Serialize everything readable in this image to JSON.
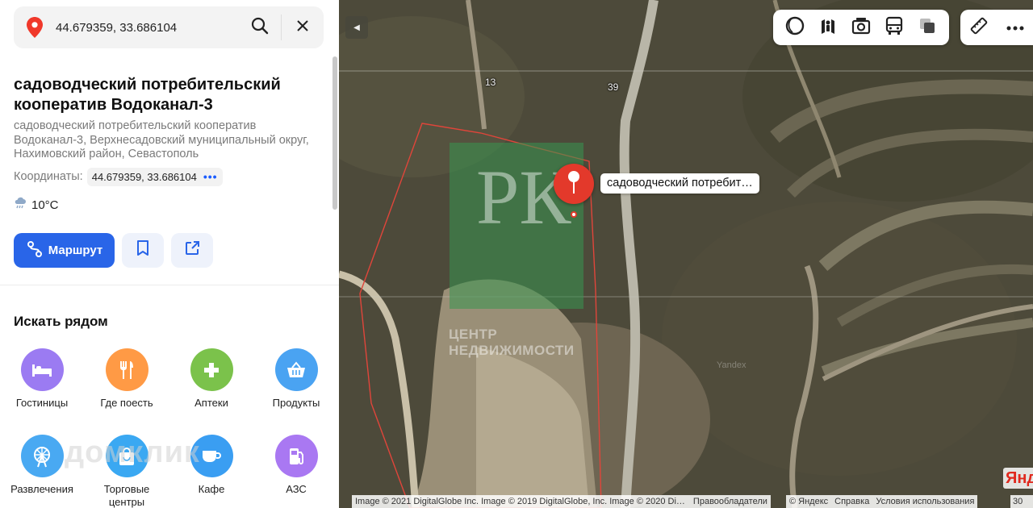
{
  "search": {
    "value": "44.679359, 33.686104",
    "icon_pin": "location-pin-icon",
    "icon_search": "search-icon",
    "icon_clear": "close-icon"
  },
  "place": {
    "title": "садоводческий потребительский кооператив Водоканал-3",
    "address": "садоводческий потребительский кооператив Водоканал-3, Верхнесадовский муниципальный округ, Нахимовский район, Севастополь",
    "coords_label": "Координаты:",
    "coords_value": "44.679359, 33.686104",
    "more_dots": "•••",
    "weather": "10°C"
  },
  "actions": {
    "route_label": "Маршрут"
  },
  "nearby": {
    "heading": "Искать рядом",
    "items": [
      {
        "label": "Гостиницы",
        "color": "#9b7bf2",
        "icon": "bed-icon"
      },
      {
        "label": "Где поесть",
        "color": "#ff9a45",
        "icon": "fork-knife-icon"
      },
      {
        "label": "Аптеки",
        "color": "#7bc24b",
        "icon": "plus-icon"
      },
      {
        "label": "Продукты",
        "color": "#4aa3f2",
        "icon": "basket-icon"
      },
      {
        "label": "Развлечения",
        "color": "#49a9f2",
        "icon": "ferris-wheel-icon"
      },
      {
        "label": "Торговые центры",
        "color": "#3aa8f2",
        "icon": "shopping-bag-icon"
      },
      {
        "label": "Кафе",
        "color": "#3a9ef2",
        "icon": "cup-icon"
      },
      {
        "label": "АЗС",
        "color": "#a978f2",
        "icon": "fuel-icon"
      }
    ]
  },
  "watermarks": {
    "domclick": "домклик",
    "rk_letters": "РК",
    "rk_text_1": "ЦЕНТР",
    "rk_text_2": "НЕДВИЖИМОСТИ",
    "yandex": "Yandex"
  },
  "map": {
    "house_numbers": [
      "13",
      "39"
    ],
    "place_label": "садоводческий потребит…",
    "collapse": "◀",
    "attribution": "Image © 2021 DigitalGlobe Inc. Image © 2019 DigitalGlobe, Inc. Image © 2020 Di…",
    "rights_link": "Правообладатели",
    "copyright": "© Яндекс",
    "help_link": "Справка",
    "terms_link": "Условия использования",
    "scale": "30",
    "logo": "Янд"
  }
}
